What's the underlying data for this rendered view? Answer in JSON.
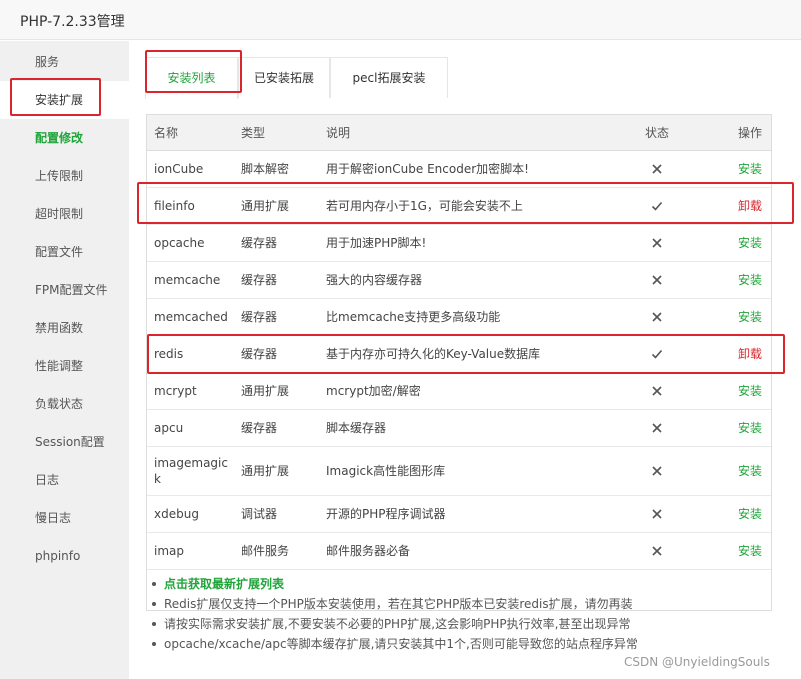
{
  "window": {
    "title": "PHP-7.2.33管理"
  },
  "sidebar": {
    "items": [
      {
        "label": "服务"
      },
      {
        "label": "安装扩展"
      },
      {
        "label": "配置修改"
      },
      {
        "label": "上传限制"
      },
      {
        "label": "超时限制"
      },
      {
        "label": "配置文件"
      },
      {
        "label": "FPM配置文件"
      },
      {
        "label": "禁用函数"
      },
      {
        "label": "性能调整"
      },
      {
        "label": "负载状态"
      },
      {
        "label": "Session配置"
      },
      {
        "label": "日志"
      },
      {
        "label": "慢日志"
      },
      {
        "label": "phpinfo"
      }
    ]
  },
  "tabs": [
    {
      "label": "安装列表"
    },
    {
      "label": "已安装拓展"
    },
    {
      "label": "pecl拓展安装"
    }
  ],
  "table": {
    "headers": {
      "name": "名称",
      "type": "类型",
      "desc": "说明",
      "state": "状态",
      "op": "操作"
    },
    "rows": [
      {
        "name": "ionCube",
        "type": "脚本解密",
        "desc": "用于解密ionCube Encoder加密脚本!",
        "installed": false,
        "op": "安装"
      },
      {
        "name": "fileinfo",
        "type": "通用扩展",
        "desc": "若可用内存小于1G，可能会安装不上",
        "installed": true,
        "op": "卸载"
      },
      {
        "name": "opcache",
        "type": "缓存器",
        "desc": "用于加速PHP脚本!",
        "installed": false,
        "op": "安装"
      },
      {
        "name": "memcache",
        "type": "缓存器",
        "desc": "强大的内容缓存器",
        "installed": false,
        "op": "安装"
      },
      {
        "name": "memcached",
        "type": "缓存器",
        "desc": "比memcache支持更多高级功能",
        "installed": false,
        "op": "安装"
      },
      {
        "name": "redis",
        "type": "缓存器",
        "desc": "基于内存亦可持久化的Key-Value数据库",
        "installed": true,
        "op": "卸载"
      },
      {
        "name": "mcrypt",
        "type": "通用扩展",
        "desc": "mcrypt加密/解密",
        "installed": false,
        "op": "安装"
      },
      {
        "name": "apcu",
        "type": "缓存器",
        "desc": "脚本缓存器",
        "installed": false,
        "op": "安装"
      },
      {
        "name": "imagemagick",
        "type": "通用扩展",
        "desc": "Imagick高性能图形库",
        "installed": false,
        "op": "安装"
      },
      {
        "name": "xdebug",
        "type": "调试器",
        "desc": "开源的PHP程序调试器",
        "installed": false,
        "op": "安装"
      },
      {
        "name": "imap",
        "type": "邮件服务",
        "desc": "邮件服务器必备",
        "installed": false,
        "op": "安装"
      }
    ]
  },
  "notes": [
    "点击获取最新扩展列表",
    "Redis扩展仅支持一个PHP版本安装使用，若在其它PHP版本已安装redis扩展，请勿再装",
    "请按实际需求安装扩展,不要安装不必要的PHP扩展,这会影响PHP执行效率,甚至出现异常",
    "opcache/xcache/apc等脚本缓存扩展,请只安装其中1个,否则可能导致您的站点程序异常"
  ],
  "watermark": "CSDN @UnyieldingSouls",
  "colors": {
    "accent": "#20a53a",
    "danger": "#d9262c",
    "highlight": "#d9262c"
  }
}
